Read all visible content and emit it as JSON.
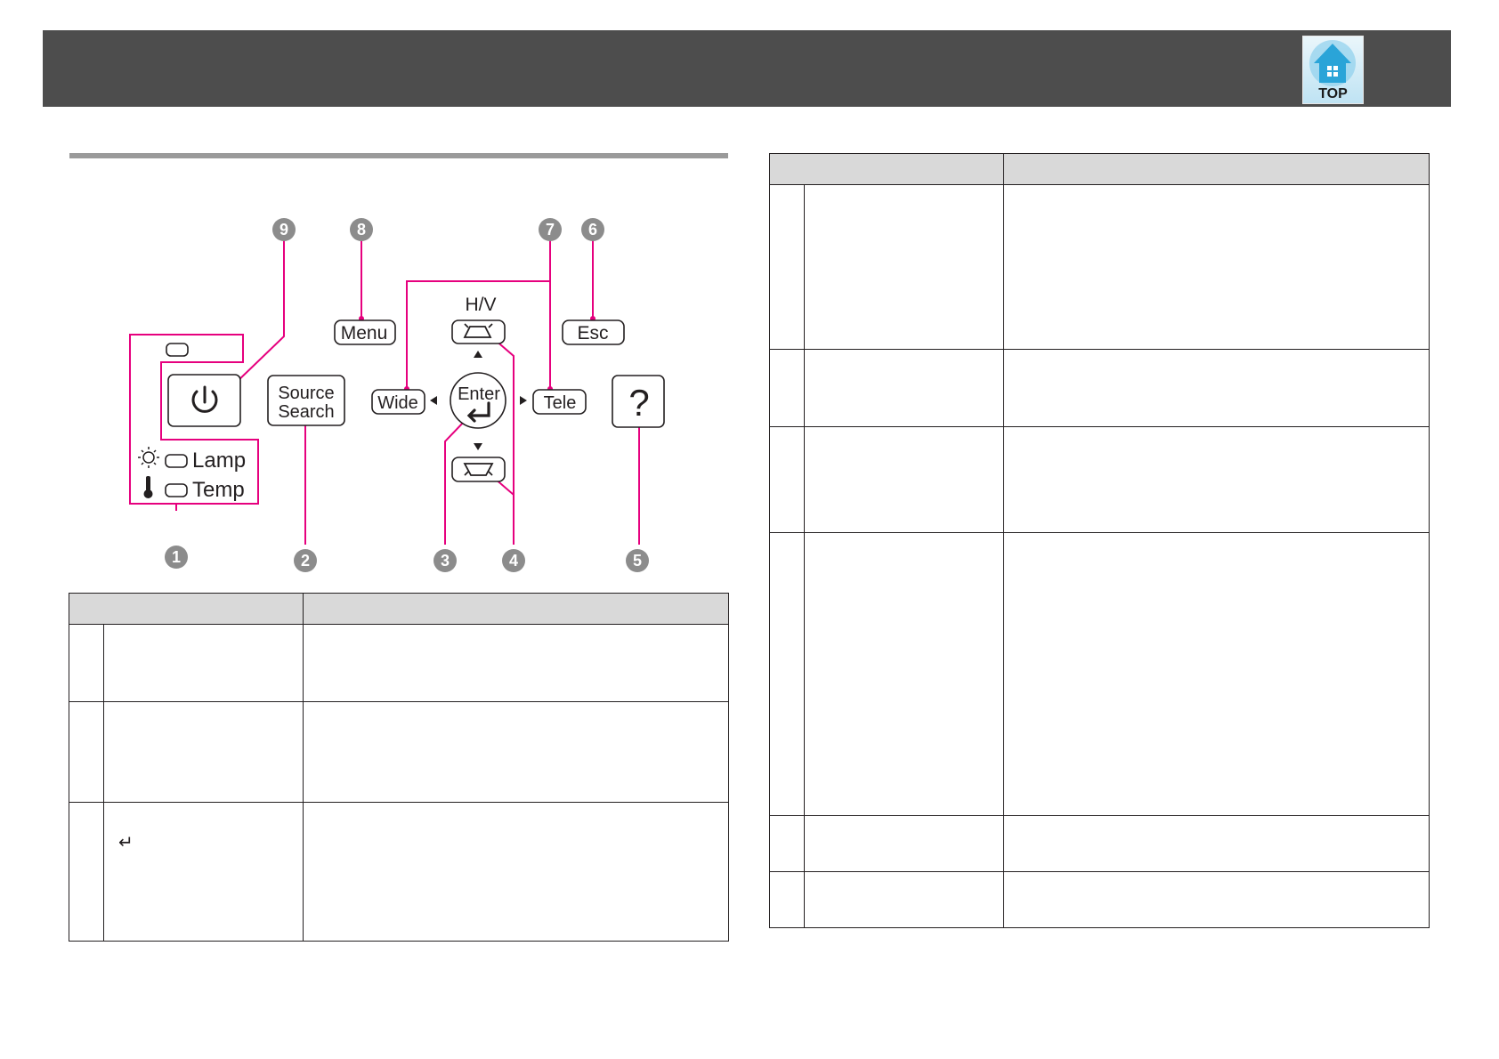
{
  "header": {
    "top_button_label": "TOP"
  },
  "diagram": {
    "callout_color": "#e6007e",
    "callouts": [
      "1",
      "2",
      "3",
      "4",
      "5",
      "6",
      "7",
      "8",
      "9"
    ],
    "keys": {
      "menu": "Menu",
      "esc": "Esc",
      "hv": "H/V",
      "wide": "Wide",
      "tele": "Tele",
      "enter": "Enter",
      "source_line1": "Source",
      "source_line2": "Search",
      "help": "?",
      "lamp": "Lamp",
      "temp": "Temp"
    },
    "icons": [
      "power-icon",
      "enter-arrow-icon",
      "sun-icon",
      "thermometer-icon",
      "keystone-up-icon",
      "keystone-down-icon"
    ]
  },
  "left_table": {
    "enter_symbol": "↵"
  }
}
